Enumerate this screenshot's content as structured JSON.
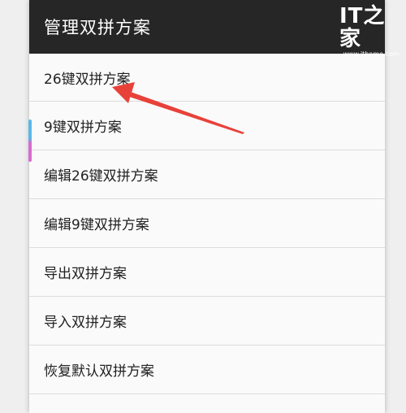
{
  "dialog": {
    "title": "管理双拼方案",
    "items": [
      {
        "label": "26键双拼方案"
      },
      {
        "label": "9键双拼方案"
      },
      {
        "label": "编辑26键双拼方案"
      },
      {
        "label": "编辑9键双拼方案"
      },
      {
        "label": "导出双拼方案"
      },
      {
        "label": "导入双拼方案"
      },
      {
        "label": "恢复默认双拼方案"
      }
    ]
  },
  "watermark": {
    "logo": "IT之家",
    "site": "www.ithome.com"
  },
  "colors": {
    "header_bg": "#262626",
    "list_bg": "#fafafa",
    "divider": "#dcdcdc",
    "annotation_arrow": "#e8413a"
  }
}
